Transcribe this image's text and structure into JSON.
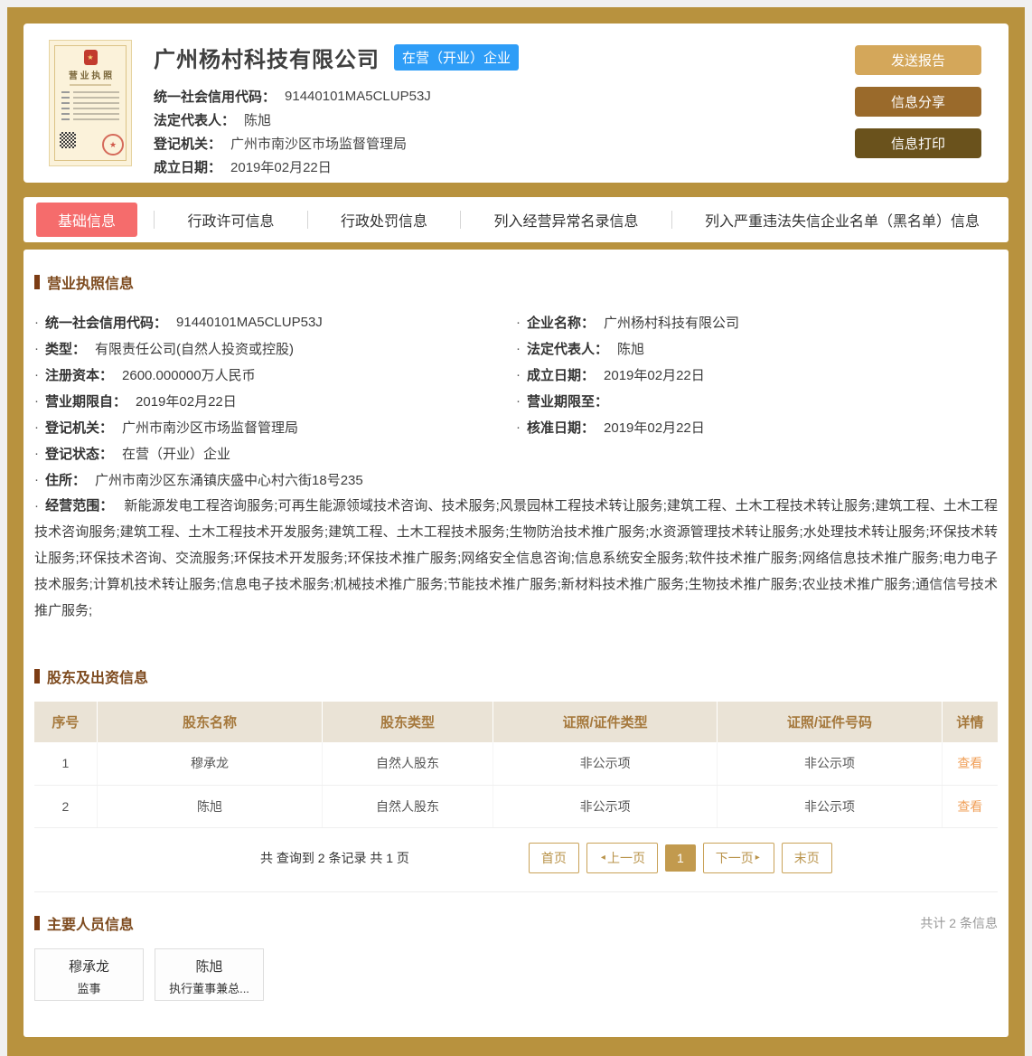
{
  "ui": {
    "bullet": "·",
    "prev_icon": "◂",
    "next_icon": "▸",
    "emblem_star": "★",
    "seal_star": "★"
  },
  "header": {
    "license_label": "营 业 执 照",
    "company_name": "广州杨村科技有限公司",
    "status_badge": "在营（开业）企业",
    "fields": [
      {
        "label": "统一社会信用代码：",
        "value": "91440101MA5CLUP53J"
      },
      {
        "label": "法定代表人：",
        "value": "陈旭"
      },
      {
        "label": "登记机关：",
        "value": "广州市南沙区市场监督管理局"
      },
      {
        "label": "成立日期：",
        "value": "2019年02月22日"
      }
    ],
    "buttons": [
      {
        "label": "发送报告"
      },
      {
        "label": "信息分享"
      },
      {
        "label": "信息打印"
      }
    ]
  },
  "tabs": [
    {
      "label": "基础信息",
      "active": true
    },
    {
      "label": "行政许可信息",
      "active": false
    },
    {
      "label": "行政处罚信息",
      "active": false
    },
    {
      "label": "列入经营异常名录信息",
      "active": false
    },
    {
      "label": "列入严重违法失信企业名单（黑名单）信息",
      "active": false
    }
  ],
  "license_section": {
    "title": "营业执照信息",
    "left_fields": [
      {
        "label": "统一社会信用代码：",
        "value": "91440101MA5CLUP53J"
      },
      {
        "label": "类型：",
        "value": "有限责任公司(自然人投资或控股)"
      },
      {
        "label": "注册资本：",
        "value": "2600.000000万人民币"
      },
      {
        "label": "营业期限自：",
        "value": "2019年02月22日"
      },
      {
        "label": "登记机关：",
        "value": "广州市南沙区市场监督管理局"
      }
    ],
    "right_fields": [
      {
        "label": "企业名称：",
        "value": "广州杨村科技有限公司"
      },
      {
        "label": "法定代表人：",
        "value": "陈旭"
      },
      {
        "label": "成立日期：",
        "value": "2019年02月22日"
      },
      {
        "label": "营业期限至：",
        "value": ""
      },
      {
        "label": "核准日期：",
        "value": "2019年02月22日"
      }
    ],
    "full_fields": [
      {
        "label": "登记状态：",
        "value": "在营（开业）企业"
      },
      {
        "label": "住所：",
        "value": "广州市南沙区东涌镇庆盛中心村六街18号235"
      }
    ],
    "scope": {
      "label": "经营范围：",
      "text": "新能源发电工程咨询服务;可再生能源领域技术咨询、技术服务;风景园林工程技术转让服务;建筑工程、土木工程技术转让服务;建筑工程、土木工程技术咨询服务;建筑工程、土木工程技术开发服务;建筑工程、土木工程技术服务;生物防治技术推广服务;水资源管理技术转让服务;水处理技术转让服务;环保技术转让服务;环保技术咨询、交流服务;环保技术开发服务;环保技术推广服务;网络安全信息咨询;信息系统安全服务;软件技术推广服务;网络信息技术推广服务;电力电子技术服务;计算机技术转让服务;信息电子技术服务;机械技术推广服务;节能技术推广服务;新材料技术推广服务;生物技术推广服务;农业技术推广服务;通信信号技术推广服务;"
    }
  },
  "shareholders": {
    "title": "股东及出资信息",
    "headers": [
      "序号",
      "股东名称",
      "股东类型",
      "证照/证件类型",
      "证照/证件号码",
      "详情"
    ],
    "rows": [
      {
        "no": "1",
        "name": "穆承龙",
        "type": "自然人股东",
        "cert_type": "非公示项",
        "cert_no": "非公示项",
        "detail": "查看"
      },
      {
        "no": "2",
        "name": "陈旭",
        "type": "自然人股东",
        "cert_type": "非公示项",
        "cert_no": "非公示项",
        "detail": "查看"
      }
    ],
    "pagination": {
      "summary": "共 查询到 2 条记录 共 1 页",
      "first": "首页",
      "prev": "上一页",
      "page": "1",
      "next": "下一页",
      "last": "末页"
    }
  },
  "key_people": {
    "title": "主要人员信息",
    "count_text": "共计 2 条信息",
    "people": [
      {
        "name": "穆承龙",
        "position": "监事"
      },
      {
        "name": "陈旭",
        "position": "执行董事兼总..."
      }
    ]
  },
  "colors": {
    "gold_background": "#b8923e",
    "send_button": "#d4a75a",
    "share_button": "#9a6a2b",
    "print_button": "#6a521c",
    "active_tab_red": "#f56c6c",
    "status_badge_blue": "#2e9df7",
    "section_title_brown": "#7d4a1e",
    "table_header_bg": "#eae3d6",
    "table_header_text": "#a5783c",
    "view_link_orange": "#f0a05a",
    "pagination_gold": "#c9a258"
  }
}
